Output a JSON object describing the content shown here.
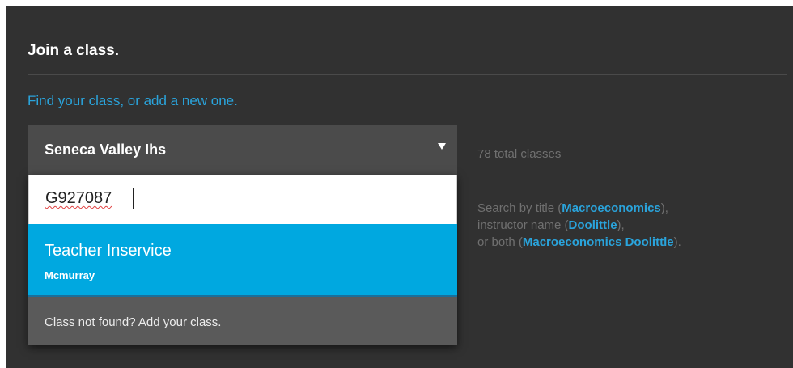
{
  "page": {
    "title": "Join a class.",
    "subtitle": "Find your class, or add a new one."
  },
  "school_select": {
    "value": "Seneca Valley Ihs",
    "icon": "dropdown-arrow-icon"
  },
  "search": {
    "value": "G927087"
  },
  "results": [
    {
      "title": "Teacher Inservice",
      "instructor": "Mcmurray"
    }
  ],
  "not_found": {
    "label": "Class not found? Add your class."
  },
  "side": {
    "count_text": "78 total classes",
    "help": {
      "line1_prefix": "Search by title (",
      "line1_link": "Macroeconomics",
      "line1_suffix": "),",
      "line2_prefix": "instructor name (",
      "line2_link": "Doolittle",
      "line2_suffix": "),",
      "line3_prefix": "or both (",
      "line3_link": "Macroeconomics Doolittle",
      "line3_suffix": ")."
    }
  },
  "colors": {
    "panel_bg": "#313131",
    "accent": "#2aa4dc",
    "selected_result": "#00a8e0",
    "select_bg": "#4b4b4b",
    "not_found_bg": "#5a5a5a",
    "muted_text": "#707070"
  }
}
